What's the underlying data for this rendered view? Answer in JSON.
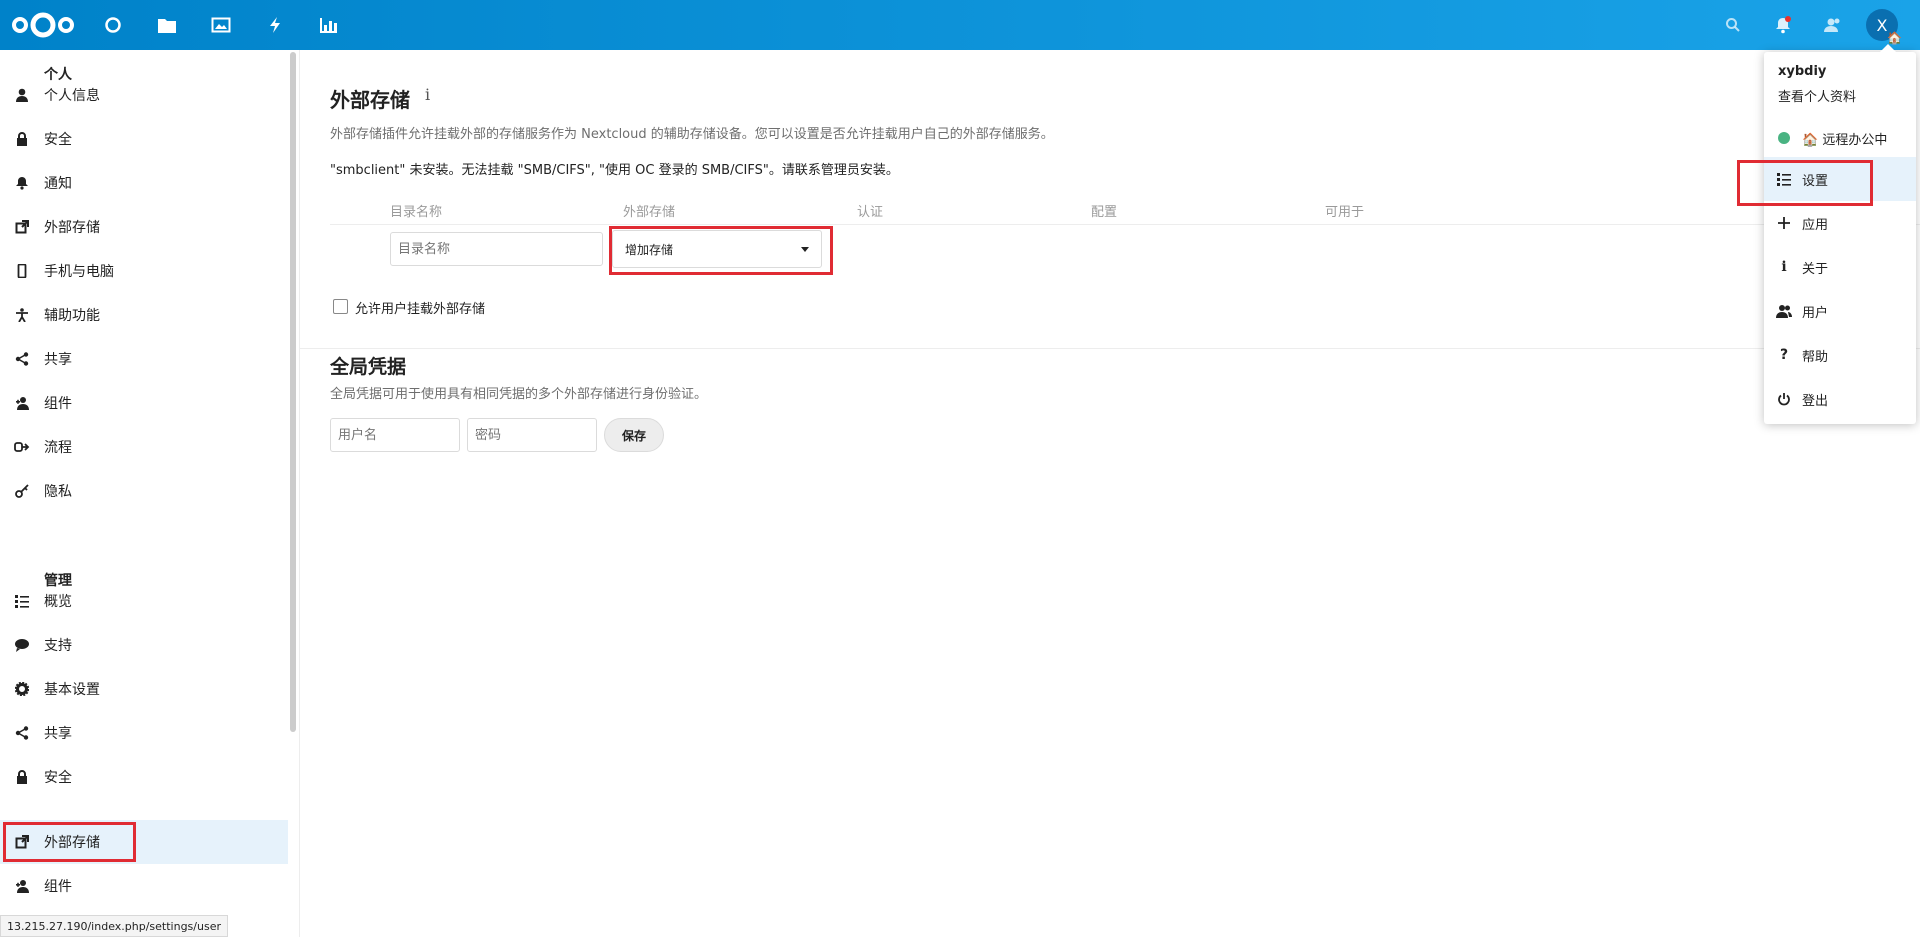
{
  "colors": {
    "header": "#0082c9",
    "accent": "#0082c9",
    "highlight_box": "#e02b33",
    "status_online": "#49b382"
  },
  "header": {
    "logo": "nextcloud-logo",
    "nav_icons": [
      "dashboard-icon",
      "files-icon",
      "photos-icon",
      "activity-icon",
      "charts-icon"
    ],
    "right_icons": [
      "search-icon",
      "notifications-icon",
      "contacts-icon"
    ],
    "avatar_letter": "X"
  },
  "sidebar": {
    "personal_heading": "个人",
    "personal_items": [
      {
        "label": "个人信息",
        "icon": "user-icon"
      },
      {
        "label": "安全",
        "icon": "lock-icon"
      },
      {
        "label": "通知",
        "icon": "bell-icon"
      },
      {
        "label": "外部存储",
        "icon": "external-icon"
      },
      {
        "label": "手机与电脑",
        "icon": "phone-icon"
      },
      {
        "label": "辅助功能",
        "icon": "accessibility-icon"
      },
      {
        "label": "共享",
        "icon": "share-icon"
      },
      {
        "label": "组件",
        "icon": "group-icon"
      },
      {
        "label": "流程",
        "icon": "flow-icon"
      },
      {
        "label": "隐私",
        "icon": "key-icon"
      }
    ],
    "admin_heading": "管理",
    "admin_items": [
      {
        "label": "概览",
        "icon": "list-icon"
      },
      {
        "label": "支持",
        "icon": "chat-icon"
      },
      {
        "label": "基本设置",
        "icon": "gear-icon"
      },
      {
        "label": "共享",
        "icon": "share-icon"
      },
      {
        "label": "安全",
        "icon": "lock-icon"
      },
      {
        "label": "外部存储",
        "icon": "external-icon"
      },
      {
        "label": "组件",
        "icon": "group-icon"
      }
    ]
  },
  "main": {
    "title": "外部存储",
    "info_glyph": "i",
    "description": "外部存储插件允许挂载外部的存储服务作为 Nextcloud 的辅助存储设备。您可以设置是否允许挂载用户自己的外部存储服务。",
    "warning": "\"smbclient\" 未安装。无法挂载 \"SMB/CIFS\", \"使用 OC 登录的 SMB/CIFS\"。请联系管理员安装。",
    "columns": [
      "目录名称",
      "外部存储",
      "认证",
      "配置",
      "可用于"
    ],
    "folder_placeholder": "目录名称",
    "add_storage": "增加存储",
    "allow_user_mount": "允许用户挂载外部存储",
    "global_title": "全局凭据",
    "global_description": "全局凭据可用于使用具有相同凭据的多个外部存储进行身份验证。",
    "username_placeholder": "用户名",
    "password_placeholder": "密码",
    "save": "保存"
  },
  "user_menu": {
    "username": "xybdiy",
    "view_profile": "查看个人资料",
    "status": "远程办公中",
    "items": [
      {
        "label": "设置",
        "icon": "settings-list-icon"
      },
      {
        "label": "应用",
        "icon": "plus-icon"
      },
      {
        "label": "关于",
        "icon": "info-icon"
      },
      {
        "label": "用户",
        "icon": "users-icon"
      },
      {
        "label": "帮助",
        "icon": "help-icon"
      },
      {
        "label": "登出",
        "icon": "power-icon"
      }
    ]
  },
  "statusbar": "13.215.27.190/index.php/settings/user"
}
